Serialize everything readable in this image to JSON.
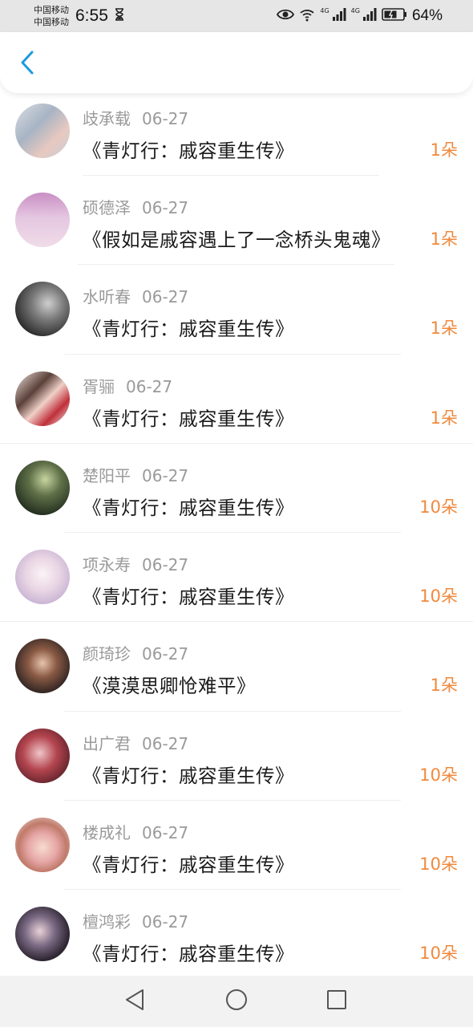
{
  "status_bar": {
    "carrier_1": "中国移动",
    "carrier_2": "中国移动",
    "time": "6:55",
    "signal_1_label": "4G",
    "signal_2_label": "4G",
    "battery": "64%"
  },
  "header": {
    "back_icon": "chevron-left-icon",
    "accent_color": "#1a9be0"
  },
  "gifts": [
    {
      "name": "歧承载",
      "date": "06-27",
      "title": "《青灯行：戚容重生传》",
      "amount": "1朵"
    },
    {
      "name": "硕德泽",
      "date": "06-27",
      "title": "《假如是戚容遇上了一念桥头鬼魂》",
      "amount": "1朵"
    },
    {
      "name": "水听春",
      "date": "06-27",
      "title": "《青灯行：戚容重生传》",
      "amount": "1朵"
    },
    {
      "name": "胥骊",
      "date": "06-27",
      "title": "《青灯行：戚容重生传》",
      "amount": "1朵"
    },
    {
      "name": "楚阳平",
      "date": "06-27",
      "title": "《青灯行：戚容重生传》",
      "amount": "10朵"
    },
    {
      "name": "项永寿",
      "date": "06-27",
      "title": "《青灯行：戚容重生传》",
      "amount": "10朵"
    },
    {
      "name": "颜琦珍",
      "date": "06-27",
      "title": "《漠漠思卿怆难平》",
      "amount": "1朵"
    },
    {
      "name": "出广君",
      "date": "06-27",
      "title": "《青灯行：戚容重生传》",
      "amount": "10朵"
    },
    {
      "name": "楼成礼",
      "date": "06-27",
      "title": "《青灯行：戚容重生传》",
      "amount": "10朵"
    },
    {
      "name": "檀鸿彩",
      "date": "06-27",
      "title": "《青灯行：戚容重生传》",
      "amount": "10朵"
    }
  ],
  "amount_color": "#f0893d",
  "nav": {
    "back": "triangle-back-icon",
    "home": "circle-home-icon",
    "recents": "square-recents-icon"
  }
}
